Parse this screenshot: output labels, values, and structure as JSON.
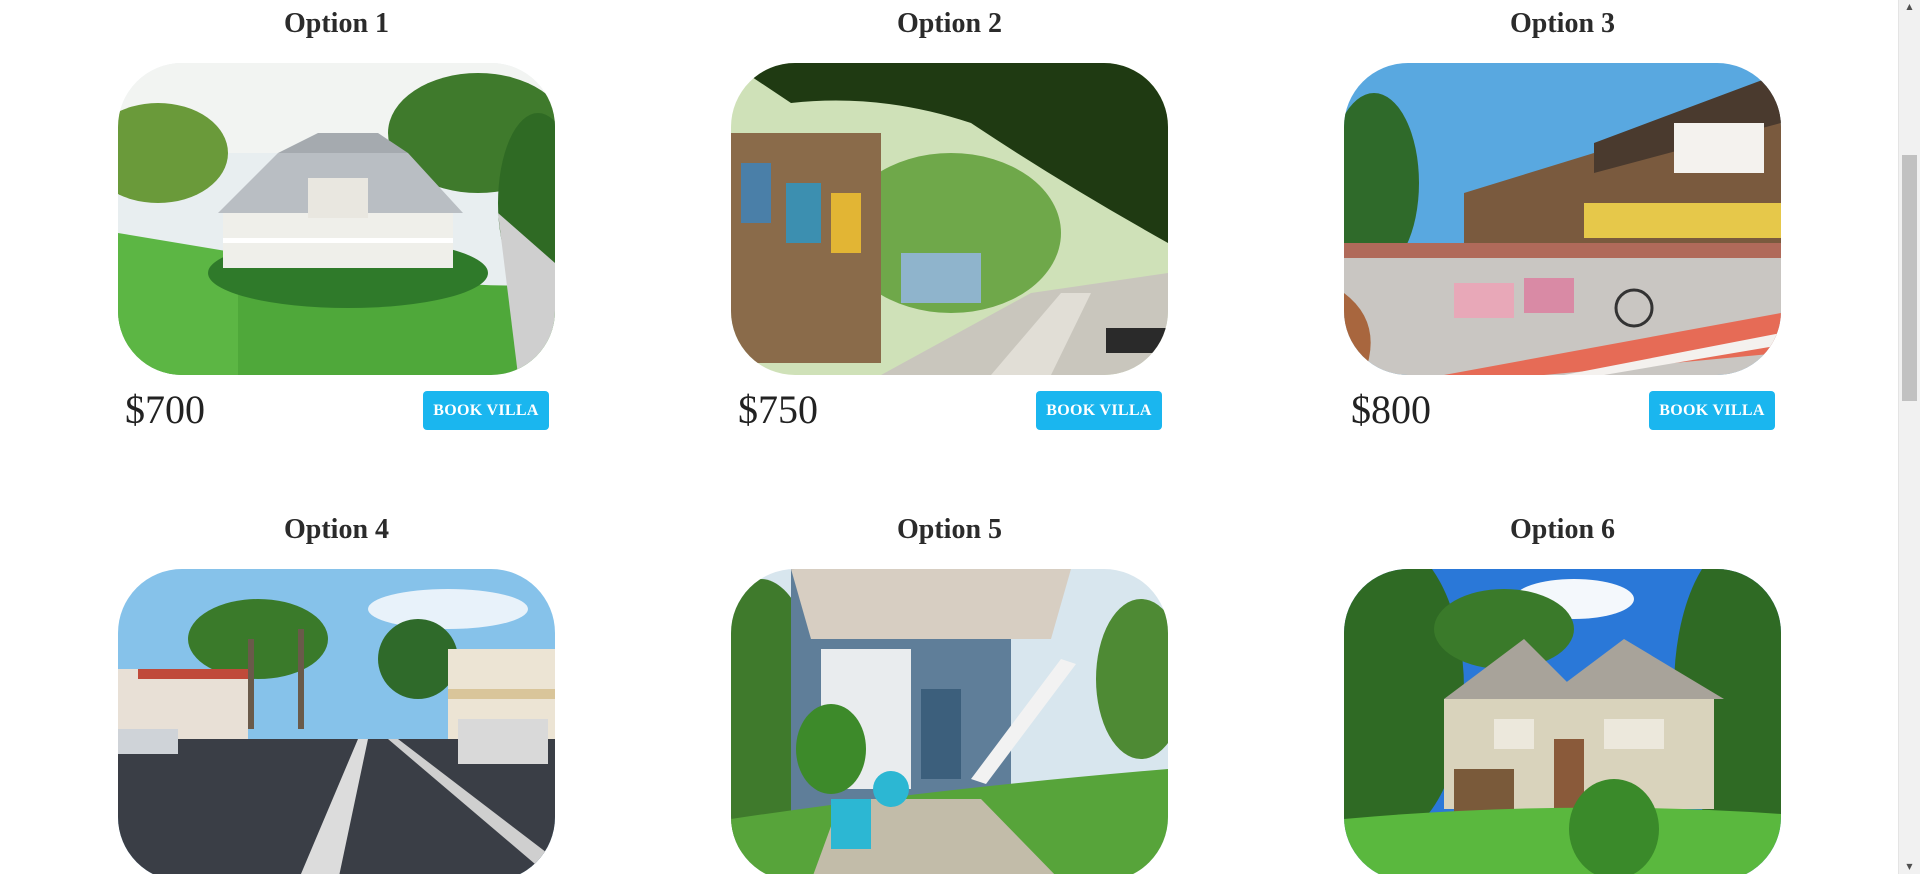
{
  "villas": [
    {
      "title": "Option 1",
      "price": "$700",
      "button": "BOOK VILLA",
      "image": "queenslander-house-aerial"
    },
    {
      "title": "Option 2",
      "price": "$750",
      "button": "BOOK VILLA",
      "image": "village-street-tree-canopy"
    },
    {
      "title": "Option 3",
      "price": "$800",
      "button": "BOOK VILLA",
      "image": "main-street-race-crowd"
    },
    {
      "title": "Option 4",
      "price": "",
      "button": "",
      "image": "palm-lined-main-road"
    },
    {
      "title": "Option 5",
      "price": "",
      "button": "",
      "image": "blue-house-stairs-garden"
    },
    {
      "title": "Option 6",
      "price": "",
      "button": "",
      "image": "cream-queenslander-garden"
    }
  ],
  "colors": {
    "button": "#1ab6ef",
    "button_text": "#ffffff",
    "title_text": "#2b2b2b"
  }
}
